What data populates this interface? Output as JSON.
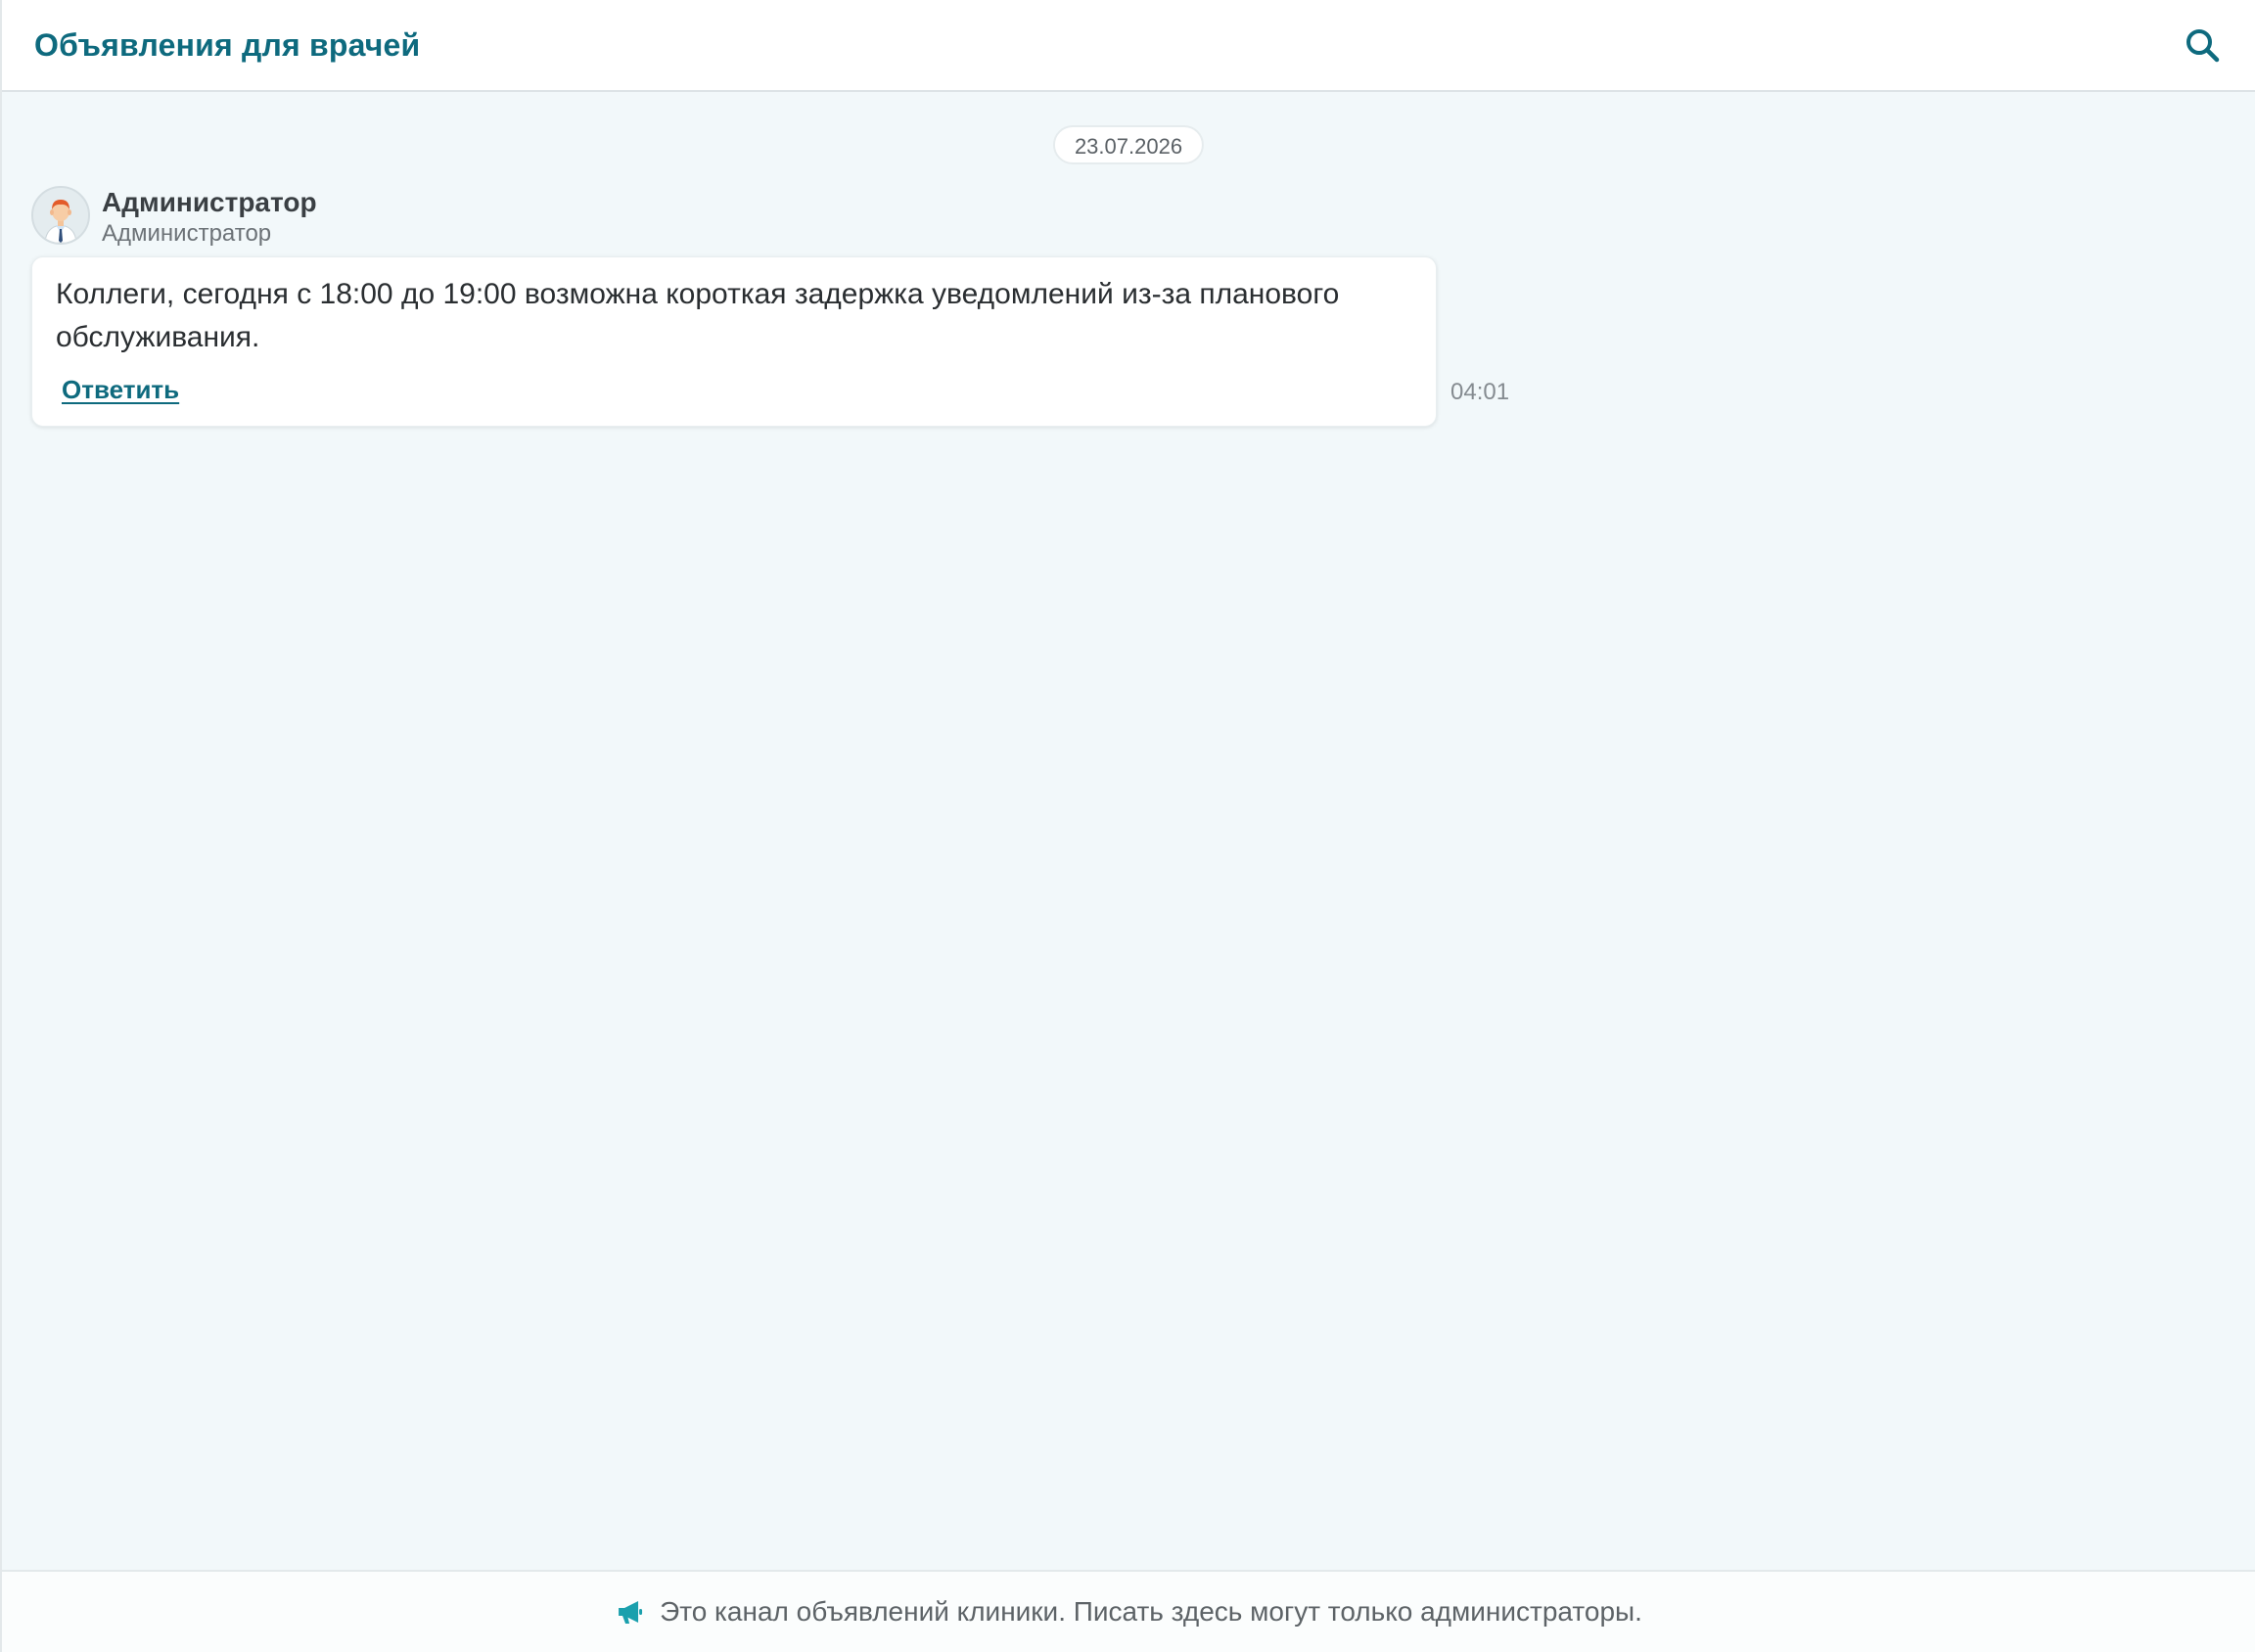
{
  "header": {
    "title": "Объявления для врачей",
    "search_icon": "search-icon"
  },
  "feed": {
    "date_separator": "23.07.2026",
    "messages": [
      {
        "sender_name": "Администратор",
        "sender_role": "Администратор",
        "avatar_icon": "doctor-avatar",
        "text": "Коллеги, сегодня с 18:00 до 19:00 возможна короткая задержка уведомлений из-за планового обслуживания.",
        "reply_label": "Ответить",
        "time": "04:01"
      }
    ]
  },
  "footer": {
    "icon": "megaphone-icon",
    "notice": "Это канал объявлений клиники. Писать здесь могут только администраторы."
  },
  "colors": {
    "accent": "#0e6a7e",
    "background": "#f2f8fa",
    "footer_icon": "#1aa0ad"
  }
}
